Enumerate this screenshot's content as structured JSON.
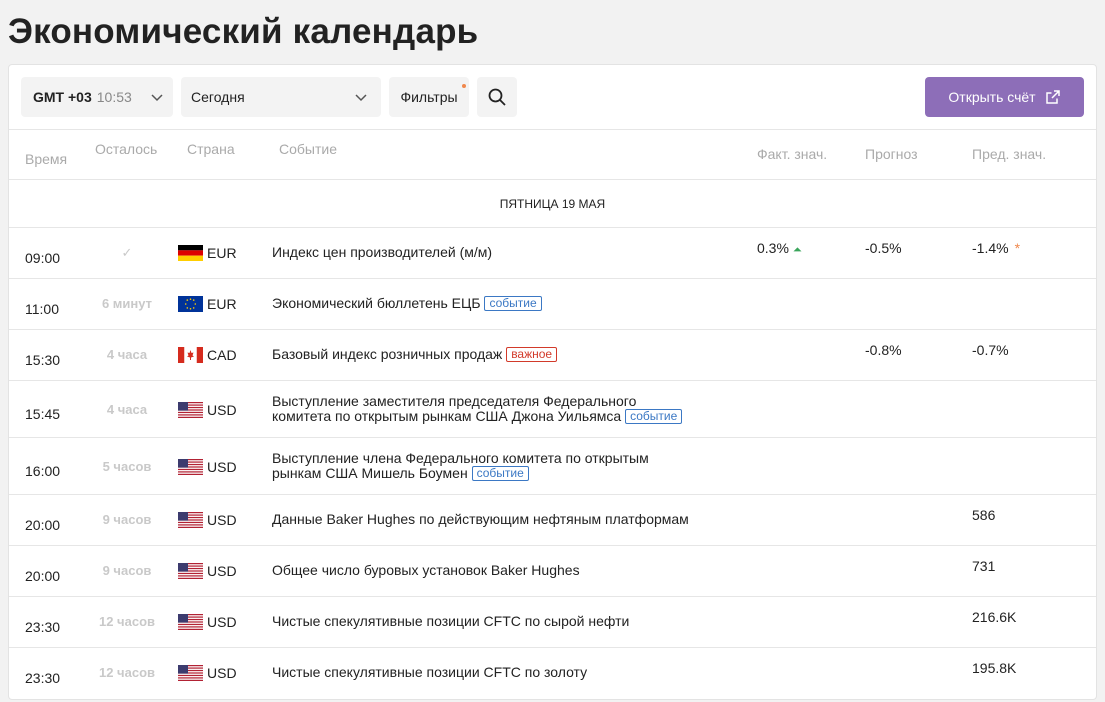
{
  "page_title": "Экономический календарь",
  "toolbar": {
    "timezone_label": "GMT +03",
    "timezone_time": "10:53",
    "day_select": "Сегодня",
    "filters_label": "Фильтры",
    "open_account_label": "Открыть счёт"
  },
  "columns": {
    "time": "Время",
    "remaining": "Осталось",
    "country": "Страна",
    "event": "Событие",
    "actual": "Факт. знач.",
    "forecast": "Прогноз",
    "previous": "Пред. знач."
  },
  "date_header": "ПЯТНИЦА 19 МАЯ",
  "badges": {
    "event": "событие",
    "important": "важное"
  },
  "rows": [
    {
      "time": "09:00",
      "remaining": "✓",
      "flag": "de-flag",
      "currency": "EUR",
      "event": "Индекс цен производителей (м/м)",
      "badge": "",
      "actual": "0.3%",
      "actual_trend": "up",
      "forecast": "-0.5%",
      "previous": "-1.4%",
      "previous_revised": "*"
    },
    {
      "time": "11:00",
      "remaining": "6 минут",
      "flag": "eu-flag",
      "currency": "EUR",
      "event": "Экономический бюллетень ЕЦБ",
      "badge": "event",
      "actual": "",
      "forecast": "",
      "previous": ""
    },
    {
      "time": "15:30",
      "remaining": "4 часа",
      "flag": "ca-flag",
      "currency": "CAD",
      "event": "Базовый индекс розничных продаж",
      "badge": "important",
      "actual": "",
      "forecast": "-0.8%",
      "previous": "-0.7%"
    },
    {
      "time": "15:45",
      "remaining": "4 часа",
      "flag": "us-flag",
      "currency": "USD",
      "event_line1": "Выступление заместителя председателя Федерального",
      "event": "комитета по открытым рынкам США Джона Уильямса",
      "badge": "event",
      "actual": "",
      "forecast": "",
      "previous": ""
    },
    {
      "time": "16:00",
      "remaining": "5 часов",
      "flag": "us-flag",
      "currency": "USD",
      "event_line1": "Выступление члена Федерального комитета по открытым",
      "event": "рынкам США Мишель Боумен",
      "badge": "event",
      "actual": "",
      "forecast": "",
      "previous": ""
    },
    {
      "time": "20:00",
      "remaining": "9 часов",
      "flag": "us-flag",
      "currency": "USD",
      "event": "Данные Baker Hughes по действующим нефтяным платформам",
      "badge": "",
      "actual": "",
      "forecast": "",
      "previous": "586"
    },
    {
      "time": "20:00",
      "remaining": "9 часов",
      "flag": "us-flag",
      "currency": "USD",
      "event": "Общее число буровых установок Baker Hughes",
      "badge": "",
      "actual": "",
      "forecast": "",
      "previous": "731"
    },
    {
      "time": "23:30",
      "remaining": "12 часов",
      "flag": "us-flag",
      "currency": "USD",
      "event": "Чистые спекулятивные позиции CFTC по сырой нефти",
      "badge": "",
      "actual": "",
      "forecast": "",
      "previous": "216.6K"
    },
    {
      "time": "23:30",
      "remaining": "12 часов",
      "flag": "us-flag",
      "currency": "USD",
      "event": "Чистые спекулятивные позиции CFTC по золоту",
      "badge": "",
      "actual": "",
      "forecast": "",
      "previous": "195.8K"
    }
  ],
  "colors": {
    "accent": "#8d6eb8",
    "event_badge": "#3b78c4",
    "important_badge": "#d23a2a",
    "up_arrow": "#3aa55b",
    "revised_marker": "#f0884d"
  }
}
